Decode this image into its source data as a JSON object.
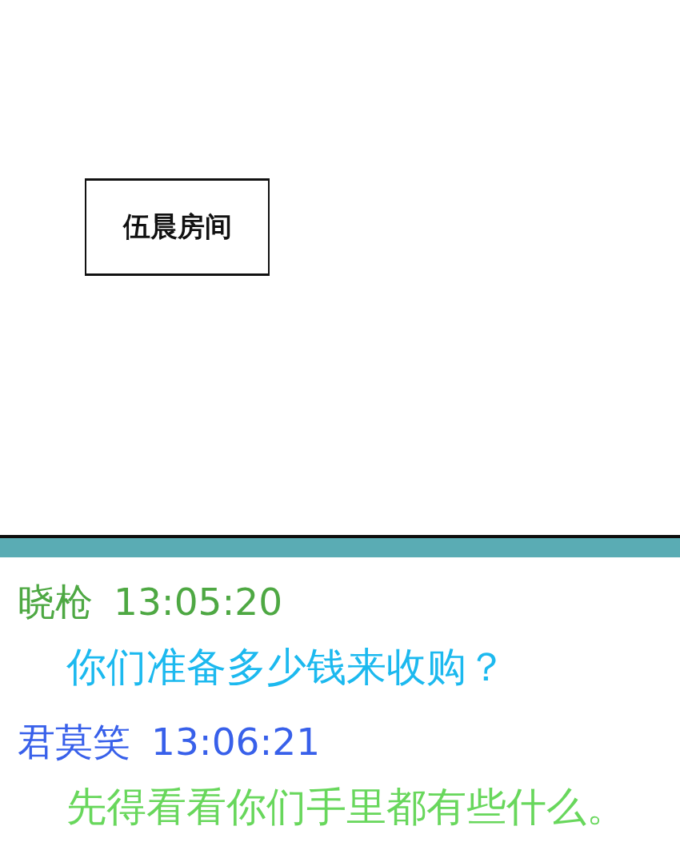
{
  "caption": {
    "text": "伍晨房间"
  },
  "messages": [
    {
      "header": {
        "sender": "晓枪",
        "time": "13:05:20",
        "color": "#4ea843"
      },
      "body": {
        "text": "你们准备多少钱来收购？",
        "color": "#1cb9ef"
      }
    },
    {
      "header": {
        "sender": "君莫笑",
        "time": "13:06:21",
        "color": "#3860ea"
      },
      "body": {
        "text": "先得看看你们手里都有些什么。",
        "color": "#68d75c"
      }
    }
  ]
}
